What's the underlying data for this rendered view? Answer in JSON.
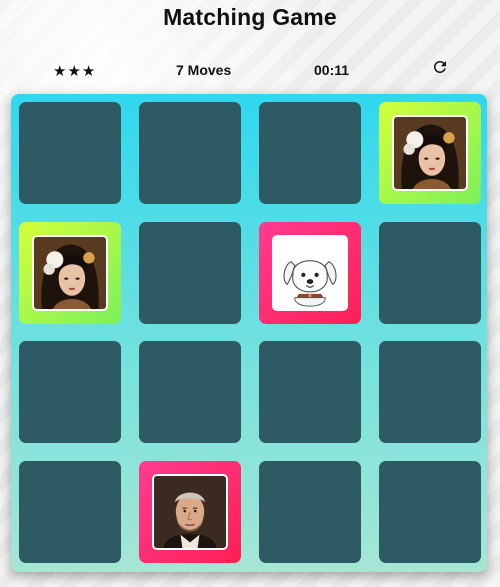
{
  "header": {
    "title": "Matching Game"
  },
  "score_panel": {
    "stars": "★★★",
    "moves": "7 Moves",
    "timer": "00:11",
    "restart_icon": "restart-icon"
  },
  "deck": {
    "columns": 4,
    "rows": 4,
    "cards": [
      {
        "state": "closed",
        "icon": ""
      },
      {
        "state": "closed",
        "icon": ""
      },
      {
        "state": "closed",
        "icon": ""
      },
      {
        "state": "match",
        "icon": "geisha-portrait-icon"
      },
      {
        "state": "match",
        "icon": "geisha-portrait-icon"
      },
      {
        "state": "closed",
        "icon": ""
      },
      {
        "state": "open",
        "icon": "white-dog-icon"
      },
      {
        "state": "closed",
        "icon": ""
      },
      {
        "state": "closed",
        "icon": ""
      },
      {
        "state": "closed",
        "icon": ""
      },
      {
        "state": "closed",
        "icon": ""
      },
      {
        "state": "closed",
        "icon": ""
      },
      {
        "state": "closed",
        "icon": ""
      },
      {
        "state": "open",
        "icon": "old-man-portrait-icon"
      },
      {
        "state": "closed",
        "icon": ""
      },
      {
        "state": "closed",
        "icon": ""
      }
    ]
  },
  "colors": {
    "card_closed": "#2e5b63",
    "card_match": "#a6f04a",
    "card_open": "#ff2f6e",
    "deck_top": "#2fd8ee",
    "deck_bottom": "#a6e6d5"
  }
}
